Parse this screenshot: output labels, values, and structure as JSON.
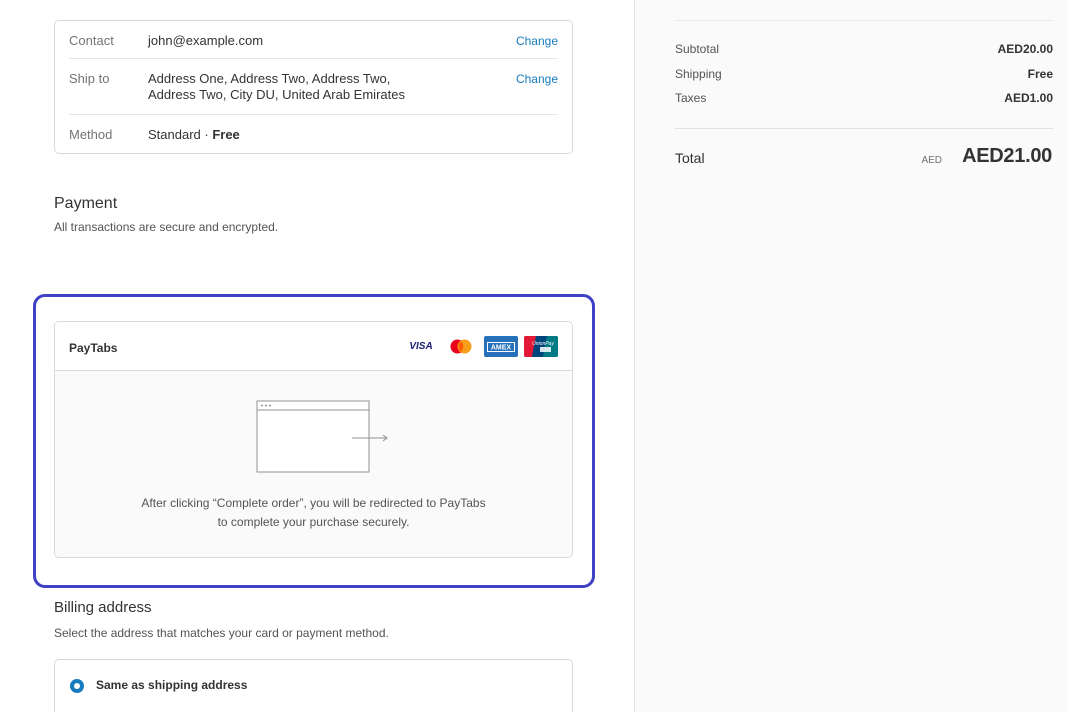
{
  "review": {
    "contact_label": "Contact",
    "contact_value": "john@example.com",
    "ship_label": "Ship to",
    "ship_value": "Address One, Address Two, Address Two, Address Two, City DU, United Arab Emirates",
    "method_label": "Method",
    "method_value": "Standard · ",
    "method_price": "Free",
    "change_label": "Change"
  },
  "payment": {
    "title": "Payment",
    "subtitle": "All transactions are secure and encrypted.",
    "gateway_name": "PayTabs",
    "cards": [
      "VISA",
      "mastercard",
      "AMEX",
      "UnionPay"
    ],
    "redirect_line1": "After clicking “Complete order”, you will be redirected to PayTabs",
    "redirect_line2": "to complete your purchase securely.",
    "highlight_color": "#4040c4"
  },
  "billing": {
    "title": "Billing address",
    "subtitle": "Select the address that matches your card or payment method.",
    "option_label": "Same as shipping address"
  },
  "summary": {
    "subtotal_label": "Subtotal",
    "subtotal_value": "AED20.00",
    "shipping_label": "Shipping",
    "shipping_value": "Free",
    "taxes_label": "Taxes",
    "taxes_value": "AED1.00",
    "total_label": "Total",
    "total_currency": "AED",
    "total_value": "AED21.00"
  }
}
